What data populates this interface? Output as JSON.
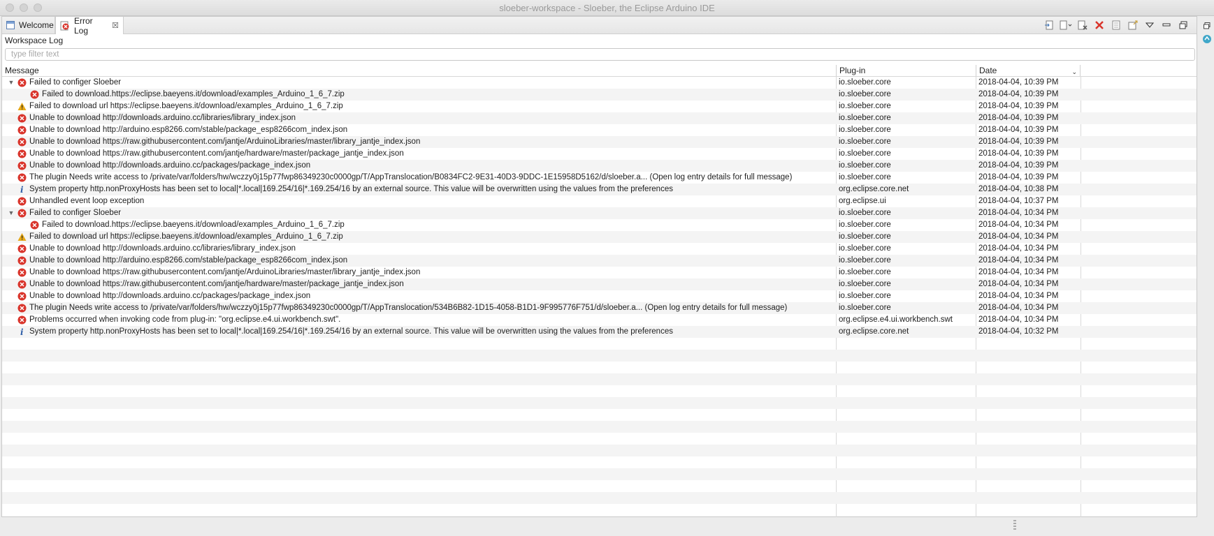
{
  "window": {
    "title": "sloeber-workspace - Sloeber, the Eclipse Arduino IDE"
  },
  "tabs": [
    {
      "label": "Welcome",
      "icon": "welcome-icon"
    },
    {
      "label": "Error Log",
      "icon": "error-log-icon",
      "active": true
    }
  ],
  "toolbar": {
    "icons": [
      "export-log-icon",
      "import-log-icon",
      "clear-log-icon",
      "delete-log-icon",
      "open-log-icon",
      "restore-log-icon",
      "view-menu-icon",
      "minimize-icon",
      "maximize-icon"
    ]
  },
  "view": {
    "subtitle": "Workspace Log",
    "filter_placeholder": "type filter text"
  },
  "columns": {
    "message": "Message",
    "plugin": "Plug-in",
    "date": "Date"
  },
  "colors": {
    "error": "#d9342b",
    "warning": "#e6a817",
    "info": "#2f5fa8",
    "alt_row": "#f4f4f4"
  },
  "entries": [
    {
      "severity": "error",
      "level": 0,
      "expanded": true,
      "message": "Failed to configer Sloeber",
      "plugin": "io.sloeber.core",
      "date": "2018-04-04, 10:39 PM"
    },
    {
      "severity": "error",
      "level": 1,
      "message": "Failed to download.https://eclipse.baeyens.it/download/examples_Arduino_1_6_7.zip",
      "plugin": "io.sloeber.core",
      "date": "2018-04-04, 10:39 PM"
    },
    {
      "severity": "warning",
      "level": 0,
      "message": "Failed to download url https://eclipse.baeyens.it/download/examples_Arduino_1_6_7.zip",
      "plugin": "io.sloeber.core",
      "date": "2018-04-04, 10:39 PM"
    },
    {
      "severity": "error",
      "level": 0,
      "message": "Unable to download http://downloads.arduino.cc/libraries/library_index.json",
      "plugin": "io.sloeber.core",
      "date": "2018-04-04, 10:39 PM"
    },
    {
      "severity": "error",
      "level": 0,
      "message": "Unable to download http://arduino.esp8266.com/stable/package_esp8266com_index.json",
      "plugin": "io.sloeber.core",
      "date": "2018-04-04, 10:39 PM"
    },
    {
      "severity": "error",
      "level": 0,
      "message": "Unable to download https://raw.githubusercontent.com/jantje/ArduinoLibraries/master/library_jantje_index.json",
      "plugin": "io.sloeber.core",
      "date": "2018-04-04, 10:39 PM"
    },
    {
      "severity": "error",
      "level": 0,
      "message": "Unable to download https://raw.githubusercontent.com/jantje/hardware/master/package_jantje_index.json",
      "plugin": "io.sloeber.core",
      "date": "2018-04-04, 10:39 PM"
    },
    {
      "severity": "error",
      "level": 0,
      "message": "Unable to download http://downloads.arduino.cc/packages/package_index.json",
      "plugin": "io.sloeber.core",
      "date": "2018-04-04, 10:39 PM"
    },
    {
      "severity": "error",
      "level": 0,
      "message": "The plugin Needs write access to /private/var/folders/hw/wczzy0j15p77fwp86349230c0000gp/T/AppTranslocation/B0834FC2-9E31-40D3-9DDC-1E15958D5162/d/sloeber.a... (Open log entry details for full message)",
      "plugin": "io.sloeber.core",
      "date": "2018-04-04, 10:39 PM"
    },
    {
      "severity": "info",
      "level": 0,
      "message": "System property http.nonProxyHosts has been set to local|*.local|169.254/16|*.169.254/16 by an external source. This value will be overwritten using the values from the preferences",
      "plugin": "org.eclipse.core.net",
      "date": "2018-04-04, 10:38 PM"
    },
    {
      "severity": "error",
      "level": 0,
      "message": "Unhandled event loop exception",
      "plugin": "org.eclipse.ui",
      "date": "2018-04-04, 10:37 PM"
    },
    {
      "severity": "error",
      "level": 0,
      "expanded": true,
      "message": "Failed to configer Sloeber",
      "plugin": "io.sloeber.core",
      "date": "2018-04-04, 10:34 PM"
    },
    {
      "severity": "error",
      "level": 1,
      "message": "Failed to download.https://eclipse.baeyens.it/download/examples_Arduino_1_6_7.zip",
      "plugin": "io.sloeber.core",
      "date": "2018-04-04, 10:34 PM"
    },
    {
      "severity": "warning",
      "level": 0,
      "message": "Failed to download url https://eclipse.baeyens.it/download/examples_Arduino_1_6_7.zip",
      "plugin": "io.sloeber.core",
      "date": "2018-04-04, 10:34 PM"
    },
    {
      "severity": "error",
      "level": 0,
      "message": "Unable to download http://downloads.arduino.cc/libraries/library_index.json",
      "plugin": "io.sloeber.core",
      "date": "2018-04-04, 10:34 PM"
    },
    {
      "severity": "error",
      "level": 0,
      "message": "Unable to download http://arduino.esp8266.com/stable/package_esp8266com_index.json",
      "plugin": "io.sloeber.core",
      "date": "2018-04-04, 10:34 PM"
    },
    {
      "severity": "error",
      "level": 0,
      "message": "Unable to download https://raw.githubusercontent.com/jantje/ArduinoLibraries/master/library_jantje_index.json",
      "plugin": "io.sloeber.core",
      "date": "2018-04-04, 10:34 PM"
    },
    {
      "severity": "error",
      "level": 0,
      "message": "Unable to download https://raw.githubusercontent.com/jantje/hardware/master/package_jantje_index.json",
      "plugin": "io.sloeber.core",
      "date": "2018-04-04, 10:34 PM"
    },
    {
      "severity": "error",
      "level": 0,
      "message": "Unable to download http://downloads.arduino.cc/packages/package_index.json",
      "plugin": "io.sloeber.core",
      "date": "2018-04-04, 10:34 PM"
    },
    {
      "severity": "error",
      "level": 0,
      "message": "The plugin Needs write access to /private/var/folders/hw/wczzy0j15p77fwp86349230c0000gp/T/AppTranslocation/534B6B82-1D15-4058-B1D1-9F995776F751/d/sloeber.a... (Open log entry details for full message)",
      "plugin": "io.sloeber.core",
      "date": "2018-04-04, 10:34 PM"
    },
    {
      "severity": "error",
      "level": 0,
      "message": "Problems occurred when invoking code from plug-in: \"org.eclipse.e4.ui.workbench.swt\".",
      "plugin": "org.eclipse.e4.ui.workbench.swt",
      "date": "2018-04-04, 10:34 PM"
    },
    {
      "severity": "info",
      "level": 0,
      "message": "System property http.nonProxyHosts has been set to local|*.local|169.254/16|*.169.254/16 by an external source. This value will be overwritten using the values from the preferences",
      "plugin": "org.eclipse.core.net",
      "date": "2018-04-04, 10:32 PM"
    }
  ]
}
